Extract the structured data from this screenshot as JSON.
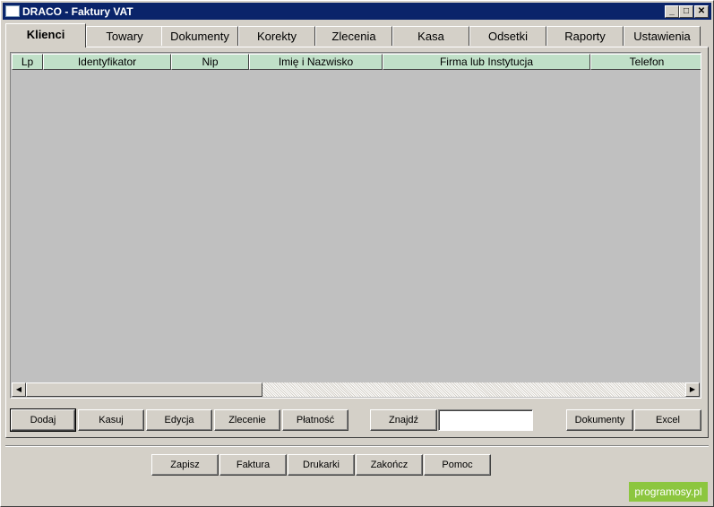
{
  "window": {
    "title": "DRACO - Faktury VAT"
  },
  "tabs": [
    "Klienci",
    "Towary",
    "Dokumenty",
    "Korekty",
    "Zlecenia",
    "Kasa",
    "Odsetki",
    "Raporty",
    "Ustawienia"
  ],
  "table": {
    "columns": [
      "Lp",
      "Identyfikator",
      "Nip",
      "Imię i Nazwisko",
      "Firma lub Instytucja",
      "Telefon"
    ],
    "rows": []
  },
  "actions": {
    "dodaj": "Dodaj",
    "kasuj": "Kasuj",
    "edycja": "Edycja",
    "zlecenie": "Zlecenie",
    "platnosc": "Płatność",
    "znajdz": "Znajdź",
    "search_value": "",
    "dokumenty": "Dokumenty",
    "excel": "Excel"
  },
  "bottom": {
    "zapisz": "Zapisz",
    "faktura": "Faktura",
    "drukarki": "Drukarki",
    "zakoncz": "Zakończ",
    "pomoc": "Pomoc"
  },
  "watermark": "programosy.pl"
}
